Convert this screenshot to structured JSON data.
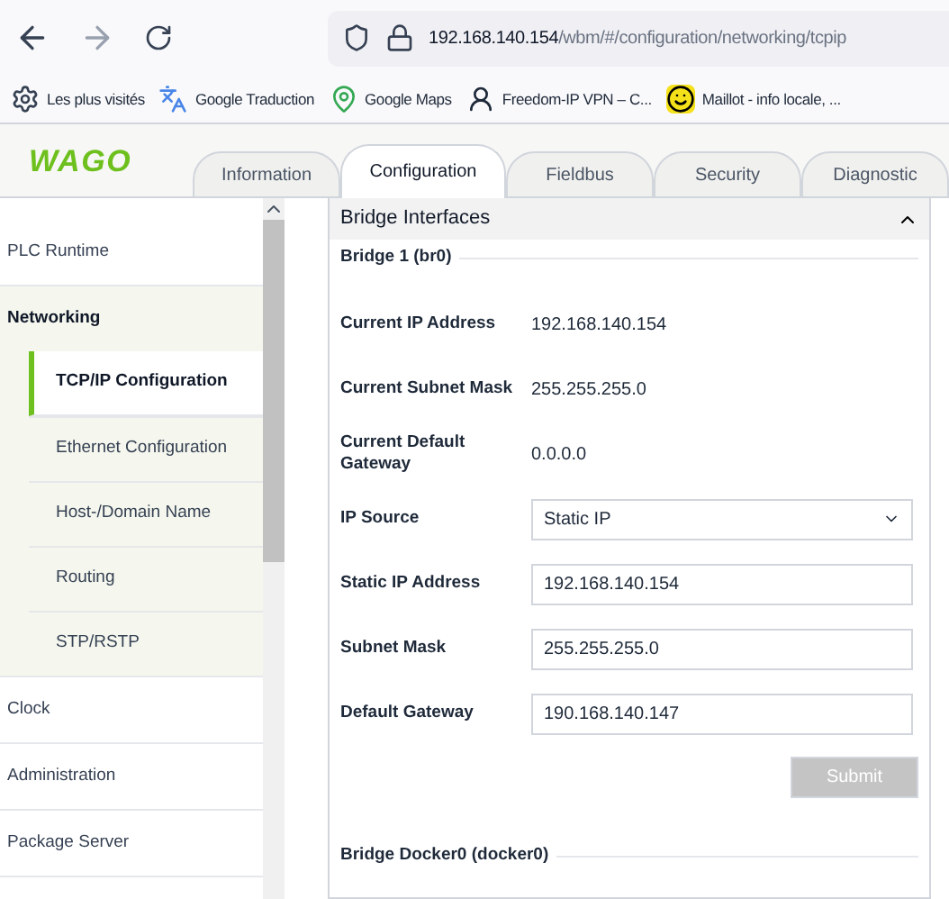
{
  "browser": {
    "url_host": "192.168.140.154",
    "url_path": "/wbm/#/configuration/networking/tcpip",
    "bookmarks": [
      {
        "label": "Les plus visités",
        "kind": "gear"
      },
      {
        "label": "Google Traduction",
        "kind": "translate"
      },
      {
        "label": "Google Maps",
        "kind": "pin"
      },
      {
        "label": "Freedom-IP VPN – C...",
        "kind": "spy"
      },
      {
        "label": "Maillot - info locale, ...",
        "kind": "smile"
      }
    ]
  },
  "header": {
    "logo": "WAGO",
    "tabs": [
      {
        "label": "Information",
        "selected": false
      },
      {
        "label": "Configuration",
        "selected": true
      },
      {
        "label": "Fieldbus",
        "selected": false
      },
      {
        "label": "Security",
        "selected": false
      },
      {
        "label": "Diagnostic",
        "selected": false
      }
    ]
  },
  "sidebar": {
    "items": [
      {
        "label": "PLC Runtime",
        "expanded": false
      },
      {
        "label": "Networking",
        "expanded": true,
        "children": [
          {
            "label": "TCP/IP Configuration",
            "selected": true
          },
          {
            "label": "Ethernet Configuration",
            "selected": false
          },
          {
            "label": "Host-/Domain Name",
            "selected": false
          },
          {
            "label": "Routing",
            "selected": false
          },
          {
            "label": "STP/RSTP",
            "selected": false
          }
        ]
      },
      {
        "label": "Clock",
        "expanded": false
      },
      {
        "label": "Administration",
        "expanded": false
      },
      {
        "label": "Package Server",
        "expanded": false
      }
    ]
  },
  "panel": {
    "title": "Bridge Interfaces",
    "expanded": true,
    "groups": [
      {
        "legend": "Bridge 1 (br0)",
        "rows": [
          {
            "kind": "text",
            "label": "Current IP Address",
            "value": "192.168.140.154"
          },
          {
            "kind": "text",
            "label": "Current Subnet Mask",
            "value": "255.255.255.0"
          },
          {
            "kind": "text",
            "label": "Current Default Gateway",
            "value": "0.0.0.0"
          },
          {
            "kind": "select",
            "label": "IP Source",
            "value": "Static IP"
          },
          {
            "kind": "input",
            "label": "Static IP Address",
            "value": "192.168.140.154"
          },
          {
            "kind": "input",
            "label": "Subnet Mask",
            "value": "255.255.255.0"
          },
          {
            "kind": "input",
            "label": "Default Gateway",
            "value": "190.168.140.147"
          }
        ],
        "submit": {
          "label": "Submit",
          "disabled": true
        }
      },
      {
        "legend": "Bridge Docker0 (docker0)"
      }
    ]
  }
}
